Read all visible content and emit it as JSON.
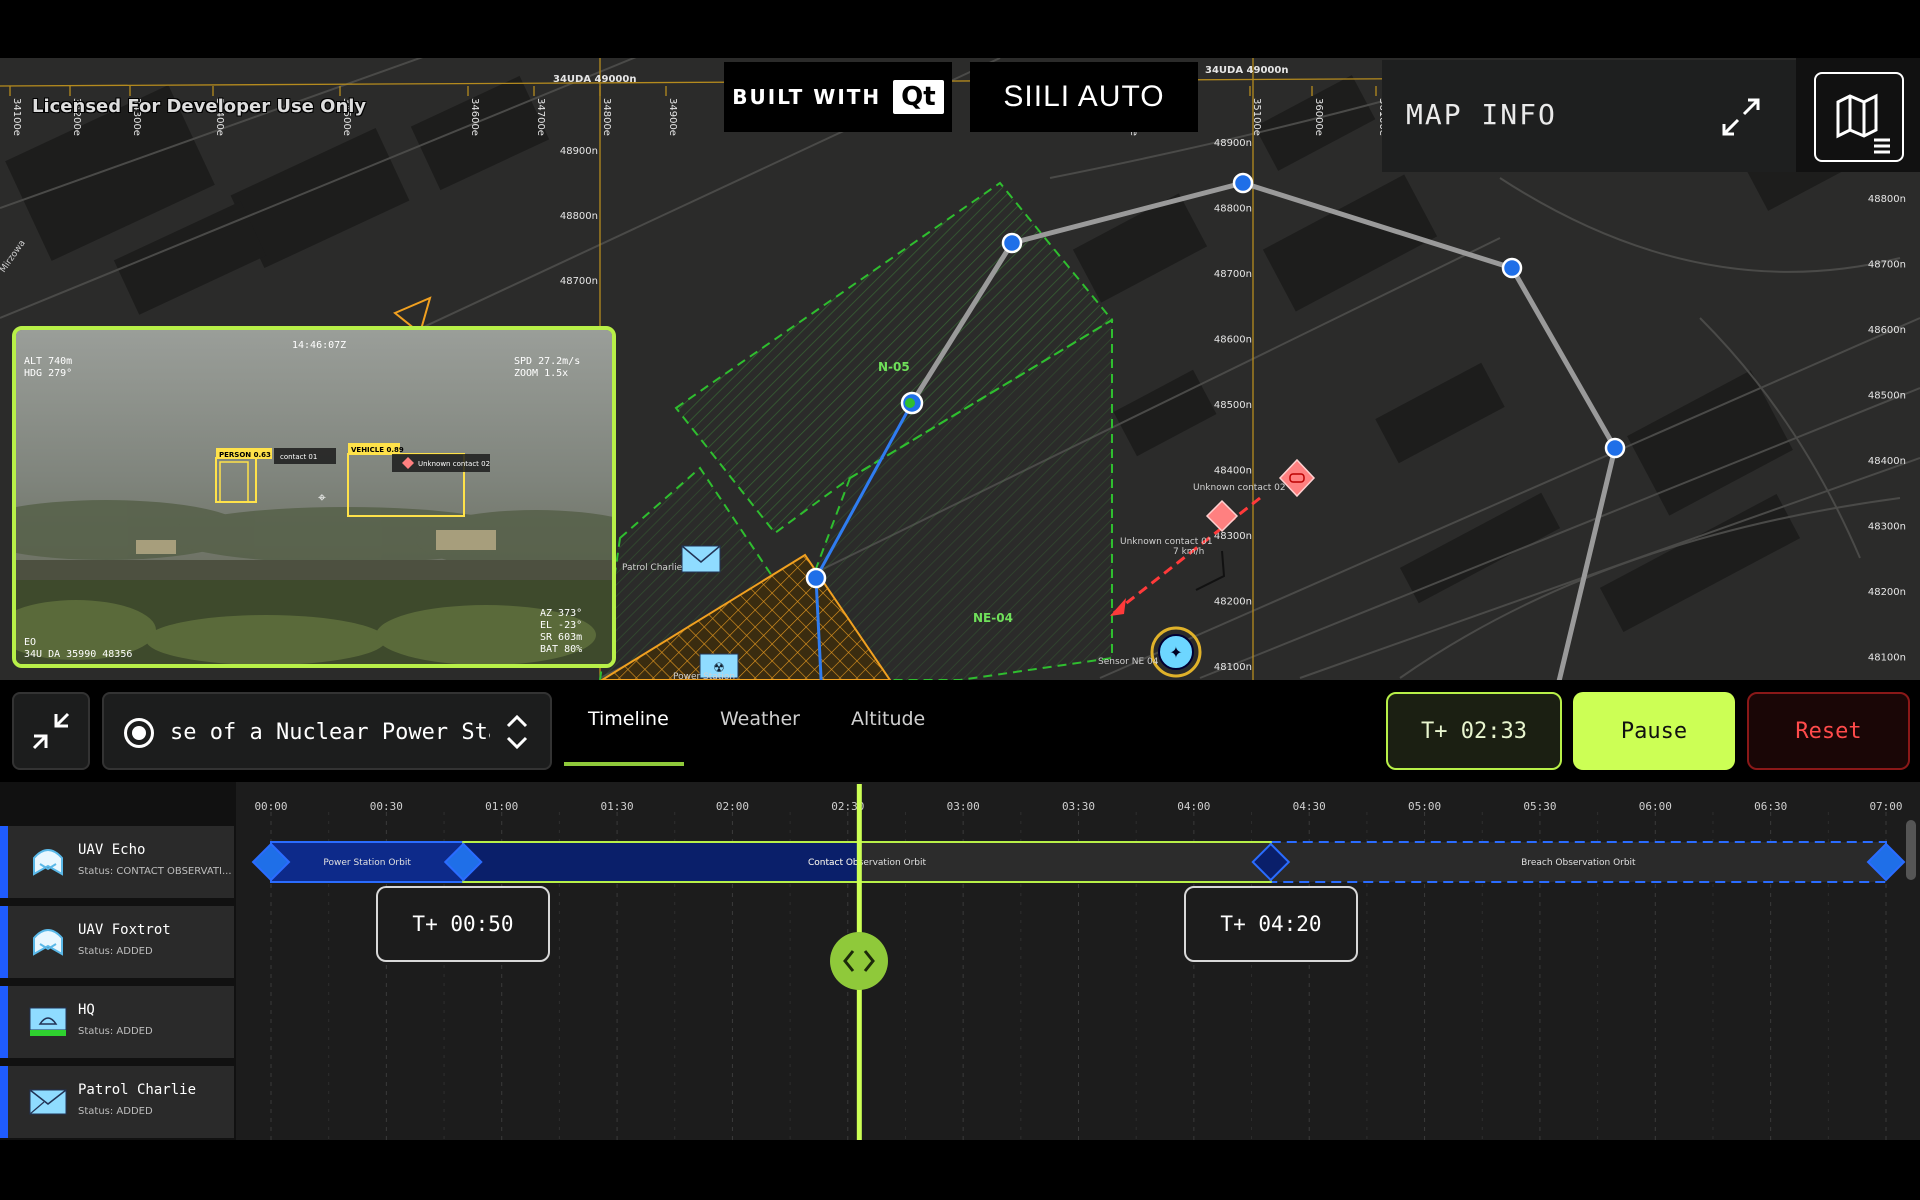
{
  "map": {
    "license": "Licensed For Developer Use Only",
    "grid_top": "34UDA 49000n",
    "grid_top_right": "34UDA 49000n",
    "easting_labels": [
      "34100e",
      "34200e",
      "34300e",
      "34400e",
      "34500e",
      "34600e",
      "34700e",
      "34800e",
      "34900e",
      "35000e",
      "35100e",
      "36000e",
      "36100e",
      "36200e"
    ],
    "northing_left": [
      "48900n",
      "48800n",
      "48700n"
    ],
    "northing_mid": [
      "48900n",
      "48800n",
      "48700n",
      "48600n",
      "48500n",
      "48400n",
      "48300n",
      "48200n",
      "48100n"
    ],
    "northing_right": [
      "48800n",
      "48700n",
      "48600n",
      "48500n",
      "48400n",
      "48300n",
      "48200n",
      "48100n"
    ],
    "zone_n05": "N-05",
    "zone_ne04": "NE-04",
    "patrol_label": "Patrol Charlie",
    "power_station_label": "Power Station",
    "contact_02_label": "Unknown contact 02",
    "contact_01_label": "Unknown contact 01",
    "contact_01_speed": "7 km/h",
    "sensor_label": "Sensor NE 04",
    "street_label": "Mirzowa",
    "colors": {
      "waypoint": "#1f6fe8",
      "route": "#9a9a9a",
      "zone": "#2fbe2f",
      "hazard": "#f0a020",
      "threat": "#ff6b6b",
      "accent": "#ccff55"
    }
  },
  "branding": {
    "built_with": "BUILT WITH",
    "qt_logo": "Qt",
    "siili": "SIILI AUTO"
  },
  "map_info": {
    "title": "MAP INFO",
    "expand_icon": "expand-icon",
    "toggle_icon": "map-layers-icon"
  },
  "camera": {
    "time": "14:46:07Z",
    "alt": "ALT  740m",
    "hdg": "HDG  279°",
    "spd": "SPD    27.2m/s",
    "zoom": "ZOOM     1.5x",
    "person_label": "PERSON 0.63",
    "person_contact": "contact 01",
    "vehicle_label": "VEHICLE 0.89",
    "vehicle_contact": "Unknown contact 02",
    "mode": "EO",
    "grid_ref": "34U DA 35990 48356",
    "az": "AZ   373°",
    "el": "EL   -23°",
    "sr": "SR   603m",
    "bat": "BAT   80%"
  },
  "controls": {
    "scenario_text": "se of a Nuclear Power Station",
    "tabs": [
      "Timeline",
      "Weather",
      "Altitude"
    ],
    "active_tab": "Timeline",
    "current_time": "T+ 02:33",
    "pause_label": "Pause",
    "reset_label": "Reset"
  },
  "timeline": {
    "ticks": [
      "00:00",
      "00:30",
      "01:00",
      "01:30",
      "02:00",
      "02:30",
      "03:00",
      "03:30",
      "04:00",
      "04:30",
      "05:00",
      "05:30",
      "06:00",
      "06:30",
      "07:00"
    ],
    "playhead_minutes": 153,
    "total_minutes": 420,
    "segments": [
      {
        "label": "Power Station Orbit",
        "start": 0,
        "end": 50
      },
      {
        "label": "Contact Observation Orbit",
        "start": 50,
        "end": 260
      },
      {
        "label": "Breach Observation Orbit",
        "start": 260,
        "end": 420
      }
    ],
    "marker_start": "T+ 00:50",
    "marker_end": "T+ 04:20",
    "assets": [
      {
        "name": "UAV Echo",
        "status": "Status: CONTACT OBSERVATI...",
        "icon": "uav-icon"
      },
      {
        "name": "UAV Foxtrot",
        "status": "Status: ADDED",
        "icon": "uav-icon"
      },
      {
        "name": "HQ",
        "status": "Status: ADDED",
        "icon": "hq-icon"
      },
      {
        "name": "Patrol Charlie",
        "status": "Status: ADDED",
        "icon": "patrol-envelope-icon"
      }
    ]
  }
}
